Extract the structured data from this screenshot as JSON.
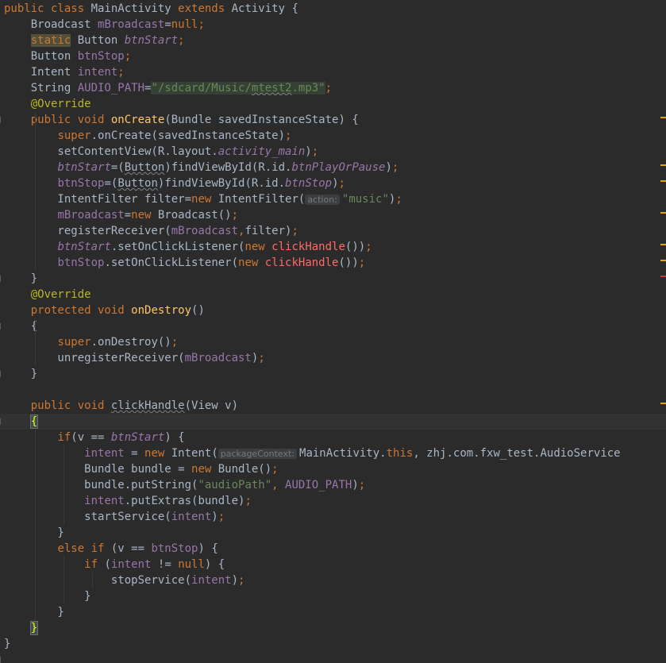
{
  "editor": {
    "lines": [
      {
        "id": "class-decl",
        "tokens": [
          {
            "t": "public class ",
            "c": "kw"
          },
          {
            "t": "MainActivity "
          },
          {
            "t": "extends ",
            "c": "kw"
          },
          {
            "t": "Activity {"
          }
        ]
      },
      {
        "id": "field-mbroadcast",
        "tokens": [
          {
            "t": "    Broadcast "
          },
          {
            "t": "mBroadcast",
            "c": "field"
          },
          {
            "t": "=",
            "c": ""
          },
          {
            "t": "null",
            "c": "kw"
          },
          {
            "t": ";",
            "c": "kw"
          }
        ]
      },
      {
        "id": "field-btnstart",
        "tokens": [
          {
            "t": "    "
          },
          {
            "t": "static",
            "c": "kw hlkw"
          },
          {
            "t": " Button "
          },
          {
            "t": "btnStart",
            "c": "ifield"
          },
          {
            "t": ";",
            "c": "kw"
          }
        ]
      },
      {
        "id": "field-btnstop",
        "tokens": [
          {
            "t": "    Button "
          },
          {
            "t": "btnStop",
            "c": "field"
          },
          {
            "t": ";",
            "c": "kw"
          }
        ]
      },
      {
        "id": "field-intent",
        "tokens": [
          {
            "t": "    Intent "
          },
          {
            "t": "intent",
            "c": "field"
          },
          {
            "t": ";",
            "c": "kw"
          }
        ]
      },
      {
        "id": "field-audiopath",
        "tokens": [
          {
            "t": "    String "
          },
          {
            "t": "AUDIO_PATH",
            "c": "field"
          },
          {
            "t": "="
          },
          {
            "t": "\"/sdcard/Music/",
            "c": "str hl"
          },
          {
            "t": "mtest2",
            "c": "str hl squig"
          },
          {
            "t": ".mp3\"",
            "c": "str hl"
          },
          {
            "t": ";",
            "c": "kw"
          }
        ]
      },
      {
        "id": "override-1",
        "tokens": [
          {
            "t": "    "
          },
          {
            "t": "@Override",
            "c": "ann"
          }
        ]
      },
      {
        "id": "oncreate-decl",
        "tokens": [
          {
            "t": "    "
          },
          {
            "t": "public void ",
            "c": "kw"
          },
          {
            "t": "onCreate",
            "c": "fn"
          },
          {
            "t": "(Bundle savedInstanceState) {"
          }
        ]
      },
      {
        "id": "super-oncreate",
        "tokens": [
          {
            "t": "        "
          },
          {
            "t": "super",
            "c": "kw"
          },
          {
            "t": ".onCreate(savedInstanceState)"
          },
          {
            "t": ";",
            "c": "kw"
          }
        ]
      },
      {
        "id": "setcontentview",
        "tokens": [
          {
            "t": "        setContentView(R.layout."
          },
          {
            "t": "activity_main",
            "c": "ifield"
          },
          {
            "t": ")"
          },
          {
            "t": ";",
            "c": "kw"
          }
        ]
      },
      {
        "id": "btnstart-find",
        "tokens": [
          {
            "t": "        "
          },
          {
            "t": "btnStart",
            "c": "ifield"
          },
          {
            "t": "=("
          },
          {
            "t": "Button",
            "c": "squig"
          },
          {
            "t": ")findViewById(R.id."
          },
          {
            "t": "btnPlayOrPause",
            "c": "ifield"
          },
          {
            "t": ")"
          },
          {
            "t": ";",
            "c": "kw"
          }
        ]
      },
      {
        "id": "btnstop-find",
        "tokens": [
          {
            "t": "        "
          },
          {
            "t": "btnStop",
            "c": "field"
          },
          {
            "t": "=("
          },
          {
            "t": "Button",
            "c": "squig"
          },
          {
            "t": ")findViewById(R.id."
          },
          {
            "t": "btnStop",
            "c": "ifield"
          },
          {
            "t": ")"
          },
          {
            "t": ";",
            "c": "kw"
          }
        ]
      },
      {
        "id": "intentfilter",
        "tokens": [
          {
            "t": "        IntentFilter filter="
          },
          {
            "t": "new ",
            "c": "kw"
          },
          {
            "t": "IntentFilter("
          },
          {
            "t": "action:",
            "c": "hint"
          },
          {
            "t": "\"music\"",
            "c": "str"
          },
          {
            "t": ")"
          },
          {
            "t": ";",
            "c": "kw"
          }
        ]
      },
      {
        "id": "new-broadcast",
        "tokens": [
          {
            "t": "        "
          },
          {
            "t": "mBroadcast",
            "c": "field"
          },
          {
            "t": "="
          },
          {
            "t": "new ",
            "c": "kw"
          },
          {
            "t": "Broadcast()"
          },
          {
            "t": ";",
            "c": "kw"
          }
        ]
      },
      {
        "id": "registerreceiver",
        "tokens": [
          {
            "t": "        registerReceiver("
          },
          {
            "t": "mBroadcast",
            "c": "field"
          },
          {
            "t": ",",
            "c": "kw"
          },
          {
            "t": "filter)"
          },
          {
            "t": ";",
            "c": "kw"
          }
        ]
      },
      {
        "id": "btnstart-listener",
        "tokens": [
          {
            "t": "        "
          },
          {
            "t": "btnStart",
            "c": "ifield"
          },
          {
            "t": ".setOnClickListener("
          },
          {
            "t": "new ",
            "c": "kw"
          },
          {
            "t": "clickHandle",
            "c": "red"
          },
          {
            "t": "())"
          },
          {
            "t": ";",
            "c": "kw"
          }
        ]
      },
      {
        "id": "btnstop-listener",
        "tokens": [
          {
            "t": "        "
          },
          {
            "t": "btnStop",
            "c": "field"
          },
          {
            "t": ".setOnClickListener("
          },
          {
            "t": "new ",
            "c": "kw"
          },
          {
            "t": "clickHandle",
            "c": "red"
          },
          {
            "t": "())"
          },
          {
            "t": ";",
            "c": "kw"
          }
        ]
      },
      {
        "id": "close-oncreate",
        "tokens": [
          {
            "t": "    }"
          }
        ]
      },
      {
        "id": "override-2",
        "tokens": [
          {
            "t": "    "
          },
          {
            "t": "@Override",
            "c": "ann"
          }
        ]
      },
      {
        "id": "ondestroy-decl",
        "tokens": [
          {
            "t": "    "
          },
          {
            "t": "protected void ",
            "c": "kw"
          },
          {
            "t": "onDestroy",
            "c": "fn"
          },
          {
            "t": "()"
          }
        ]
      },
      {
        "id": "open-ondestroy",
        "tokens": [
          {
            "t": "    {"
          }
        ]
      },
      {
        "id": "super-ondestroy",
        "tokens": [
          {
            "t": "        "
          },
          {
            "t": "super",
            "c": "kw"
          },
          {
            "t": ".onDestroy()"
          },
          {
            "t": ";",
            "c": "kw"
          }
        ]
      },
      {
        "id": "unregister",
        "tokens": [
          {
            "t": "        unregisterReceiver("
          },
          {
            "t": "mBroadcast",
            "c": "field"
          },
          {
            "t": ")"
          },
          {
            "t": ";",
            "c": "kw"
          }
        ]
      },
      {
        "id": "close-ondestroy",
        "tokens": [
          {
            "t": "    }"
          }
        ]
      },
      {
        "id": "blank-1",
        "tokens": [
          {
            "t": ""
          }
        ]
      },
      {
        "id": "clickhandle-decl",
        "tokens": [
          {
            "t": "    "
          },
          {
            "t": "public void ",
            "c": "kw"
          },
          {
            "t": "clickHandle",
            "c": "squig"
          },
          {
            "t": "(View v)"
          }
        ]
      },
      {
        "id": "open-clickhandle",
        "tokens": [
          {
            "t": "    "
          },
          {
            "t": "{",
            "c": "brace"
          }
        ]
      },
      {
        "id": "if-btnstart",
        "tokens": [
          {
            "t": "        "
          },
          {
            "t": "if",
            "c": "kw"
          },
          {
            "t": "(v == "
          },
          {
            "t": "btnStart",
            "c": "ifield"
          },
          {
            "t": ") {"
          }
        ]
      },
      {
        "id": "new-intent",
        "tokens": [
          {
            "t": "            "
          },
          {
            "t": "intent",
            "c": "field"
          },
          {
            "t": " = "
          },
          {
            "t": "new ",
            "c": "kw"
          },
          {
            "t": "Intent("
          },
          {
            "t": "packageContext:",
            "c": "hint"
          },
          {
            "t": "MainActivity."
          },
          {
            "t": "this",
            "c": "kw"
          },
          {
            "t": ", zhj.com.fxw_test.AudioService"
          }
        ]
      },
      {
        "id": "new-bundle",
        "tokens": [
          {
            "t": "            Bundle bundle = "
          },
          {
            "t": "new ",
            "c": "kw"
          },
          {
            "t": "Bundle()"
          },
          {
            "t": ";",
            "c": "kw"
          }
        ]
      },
      {
        "id": "putstring",
        "tokens": [
          {
            "t": "            bundle.putString("
          },
          {
            "t": "\"audioPath\"",
            "c": "str"
          },
          {
            "t": ", ",
            "c": "kw"
          },
          {
            "t": "AUDIO_PATH",
            "c": "field"
          },
          {
            "t": ")"
          },
          {
            "t": ";",
            "c": "kw"
          }
        ]
      },
      {
        "id": "putextras",
        "tokens": [
          {
            "t": "            "
          },
          {
            "t": "intent",
            "c": "field"
          },
          {
            "t": ".putExtras(bundle)"
          },
          {
            "t": ";",
            "c": "kw"
          }
        ]
      },
      {
        "id": "startservice",
        "tokens": [
          {
            "t": "            startService("
          },
          {
            "t": "intent",
            "c": "field"
          },
          {
            "t": ")"
          },
          {
            "t": ";",
            "c": "kw"
          }
        ]
      },
      {
        "id": "close-if",
        "tokens": [
          {
            "t": "        }"
          }
        ]
      },
      {
        "id": "else-if",
        "tokens": [
          {
            "t": "        "
          },
          {
            "t": "else if ",
            "c": "kw"
          },
          {
            "t": "(v == "
          },
          {
            "t": "btnStop",
            "c": "field"
          },
          {
            "t": ") {"
          }
        ]
      },
      {
        "id": "if-intent-null",
        "tokens": [
          {
            "t": "            "
          },
          {
            "t": "if ",
            "c": "kw"
          },
          {
            "t": "("
          },
          {
            "t": "intent",
            "c": "field"
          },
          {
            "t": " != "
          },
          {
            "t": "null",
            "c": "kw"
          },
          {
            "t": ") {"
          }
        ]
      },
      {
        "id": "stopservice",
        "tokens": [
          {
            "t": "                stopService("
          },
          {
            "t": "intent",
            "c": "field"
          },
          {
            "t": ")"
          },
          {
            "t": ";",
            "c": "kw"
          }
        ]
      },
      {
        "id": "close-inner-if",
        "tokens": [
          {
            "t": "            }"
          }
        ]
      },
      {
        "id": "close-else",
        "tokens": [
          {
            "t": "        }"
          }
        ]
      },
      {
        "id": "close-clickhandle",
        "tokens": [
          {
            "t": "    "
          },
          {
            "t": "}",
            "c": "brace"
          }
        ]
      },
      {
        "id": "close-class",
        "tokens": [
          {
            "t": "}"
          }
        ]
      }
    ],
    "caret_line_index": 26,
    "gutter_markers": [
      {
        "line": 7,
        "color": "#e0a500"
      },
      {
        "line": 10,
        "color": "#e0a500"
      },
      {
        "line": 11,
        "color": "#e0a500"
      },
      {
        "line": 13,
        "color": "#e0a500"
      },
      {
        "line": 15,
        "color": "#e0a500"
      },
      {
        "line": 16,
        "color": "#e0a500"
      },
      {
        "line": 17,
        "color": "#bc3f3c"
      },
      {
        "line": 25,
        "color": "#e0a500"
      }
    ]
  }
}
